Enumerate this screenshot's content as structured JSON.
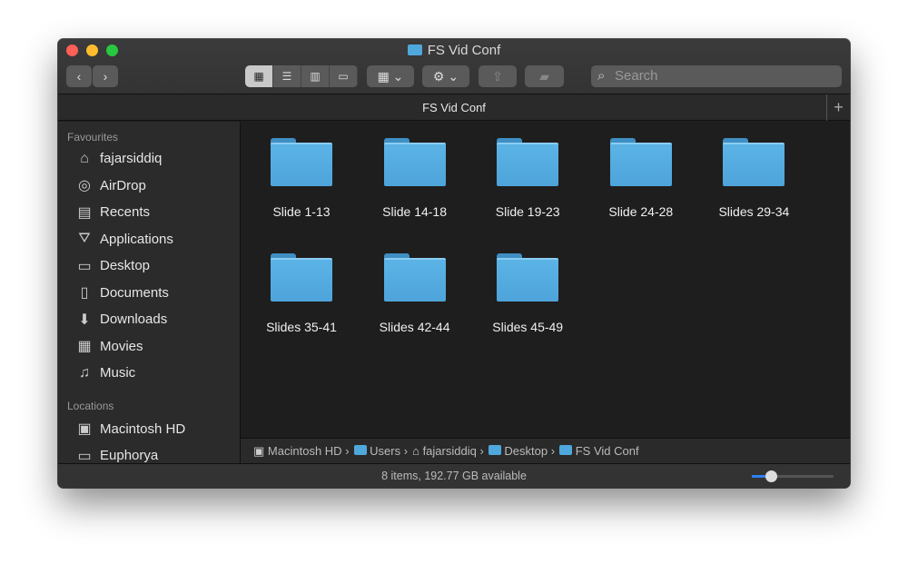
{
  "window": {
    "title": "FS Vid Conf",
    "tab_title": "FS Vid Conf"
  },
  "toolbar": {
    "back": "‹",
    "forward": "›",
    "search_placeholder": "Search"
  },
  "sidebar": {
    "favourites_header": "Favourites",
    "favourites": [
      {
        "label": "fajarsiddiq",
        "icon": "home-icon"
      },
      {
        "label": "AirDrop",
        "icon": "airdrop-icon"
      },
      {
        "label": "Recents",
        "icon": "recents-icon"
      },
      {
        "label": "Applications",
        "icon": "applications-icon"
      },
      {
        "label": "Desktop",
        "icon": "desktop-icon"
      },
      {
        "label": "Documents",
        "icon": "documents-icon"
      },
      {
        "label": "Downloads",
        "icon": "downloads-icon"
      },
      {
        "label": "Movies",
        "icon": "movies-icon"
      },
      {
        "label": "Music",
        "icon": "music-icon"
      }
    ],
    "locations_header": "Locations",
    "locations": [
      {
        "label": "Macintosh HD",
        "icon": "hard-drive-icon"
      },
      {
        "label": "Euphorya",
        "icon": "computer-icon"
      }
    ]
  },
  "items": [
    "Slide 1-13",
    "Slide 14-18",
    "Slide 19-23",
    "Slide 24-28",
    "Slides 29-34",
    "Slides 35-41",
    "Slides 42-44",
    "Slides 45-49"
  ],
  "path": [
    "Macintosh HD",
    "Users",
    "fajarsiddiq",
    "Desktop",
    "FS Vid Conf"
  ],
  "status": "8 items, 192.77 GB available",
  "icon_size_fraction": 0.2
}
